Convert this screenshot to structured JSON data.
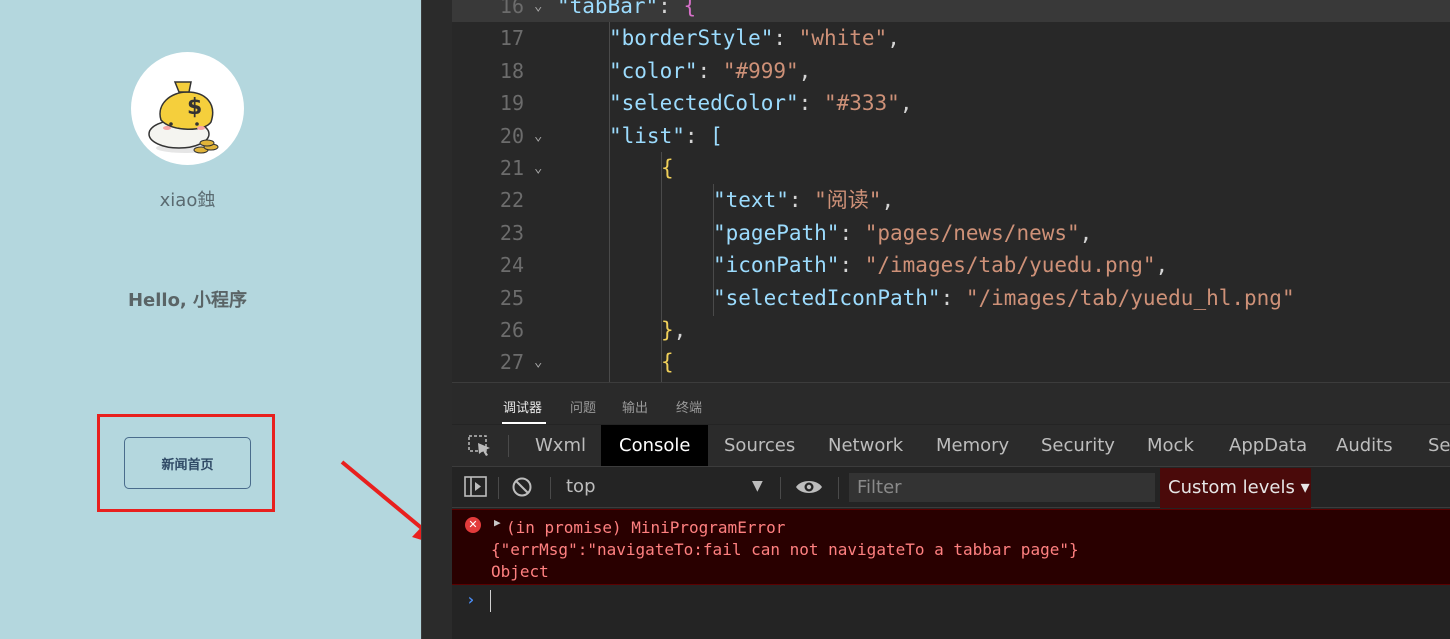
{
  "simulator": {
    "nickname": "xiao鉵",
    "greeting": "Hello, 小程序",
    "news_button_label": "新闻首页"
  },
  "editor": {
    "lines": [
      {
        "n": "16",
        "fold": "⌄",
        "parts": [
          [
            "tok-key",
            "\"tabBar\""
          ],
          [
            "tok-punc",
            ": "
          ],
          [
            "tok-brace2",
            "{"
          ]
        ]
      },
      {
        "n": "17",
        "fold": "",
        "parts": [
          [
            "tok-key",
            "\"borderStyle\""
          ],
          [
            "tok-punc",
            ": "
          ],
          [
            "tok-str",
            "\"white\""
          ],
          [
            "tok-punc",
            ","
          ]
        ]
      },
      {
        "n": "18",
        "fold": "",
        "parts": [
          [
            "tok-key",
            "\"color\""
          ],
          [
            "tok-punc",
            ": "
          ],
          [
            "tok-str",
            "\"#999\""
          ],
          [
            "tok-punc",
            ","
          ]
        ]
      },
      {
        "n": "19",
        "fold": "",
        "parts": [
          [
            "tok-key",
            "\"selectedColor\""
          ],
          [
            "tok-punc",
            ": "
          ],
          [
            "tok-str",
            "\"#333\""
          ],
          [
            "tok-punc",
            ","
          ]
        ]
      },
      {
        "n": "20",
        "fold": "⌄",
        "parts": [
          [
            "tok-key",
            "\"list\""
          ],
          [
            "tok-punc",
            ": "
          ],
          [
            "tok-key",
            "["
          ]
        ]
      },
      {
        "n": "21",
        "fold": "⌄",
        "parts": [
          [
            "tok-brace",
            "{"
          ]
        ]
      },
      {
        "n": "22",
        "fold": "",
        "parts": [
          [
            "tok-key",
            "\"text\""
          ],
          [
            "tok-punc",
            ": "
          ],
          [
            "tok-str",
            "\"阅读\""
          ],
          [
            "tok-punc",
            ","
          ]
        ]
      },
      {
        "n": "23",
        "fold": "",
        "parts": [
          [
            "tok-key",
            "\"pagePath\""
          ],
          [
            "tok-punc",
            ": "
          ],
          [
            "tok-str",
            "\"pages/news/news\""
          ],
          [
            "tok-punc",
            ","
          ]
        ]
      },
      {
        "n": "24",
        "fold": "",
        "parts": [
          [
            "tok-key",
            "\"iconPath\""
          ],
          [
            "tok-punc",
            ": "
          ],
          [
            "tok-str",
            "\"/images/tab/yuedu.png\""
          ],
          [
            "tok-punc",
            ","
          ]
        ]
      },
      {
        "n": "25",
        "fold": "",
        "parts": [
          [
            "tok-key",
            "\"selectedIconPath\""
          ],
          [
            "tok-punc",
            ": "
          ],
          [
            "tok-str",
            "\"/images/tab/yuedu_hl.png\""
          ]
        ]
      },
      {
        "n": "26",
        "fold": "",
        "parts": [
          [
            "tok-brace",
            "}"
          ],
          [
            "tok-punc",
            ","
          ]
        ]
      },
      {
        "n": "27",
        "fold": "⌄",
        "parts": [
          [
            "tok-brace",
            "{"
          ]
        ]
      }
    ]
  },
  "devtools": {
    "top_tabs": [
      "调试器",
      "问题",
      "输出",
      "终端"
    ],
    "panel_tabs": [
      "Wxml",
      "Console",
      "Sources",
      "Network",
      "Memory",
      "Security",
      "Mock",
      "AppData",
      "Audits",
      "Se"
    ],
    "active_panel": "Console",
    "context": "top",
    "filter_placeholder": "Filter",
    "levels_label": "Custom levels ▾",
    "error": {
      "line1": "(in promise) MiniProgramError",
      "line2": "{\"errMsg\":\"navigateTo:fail can not navigateTo a tabbar page\"}",
      "line3": "Object"
    },
    "prompt": "›"
  },
  "colors": {
    "simulator_bg": "#b4d7de",
    "highlight": "#e8201e",
    "error_bg": "#290000",
    "error_text": "#ff8080",
    "levels_bg": "#4a0a0a"
  }
}
